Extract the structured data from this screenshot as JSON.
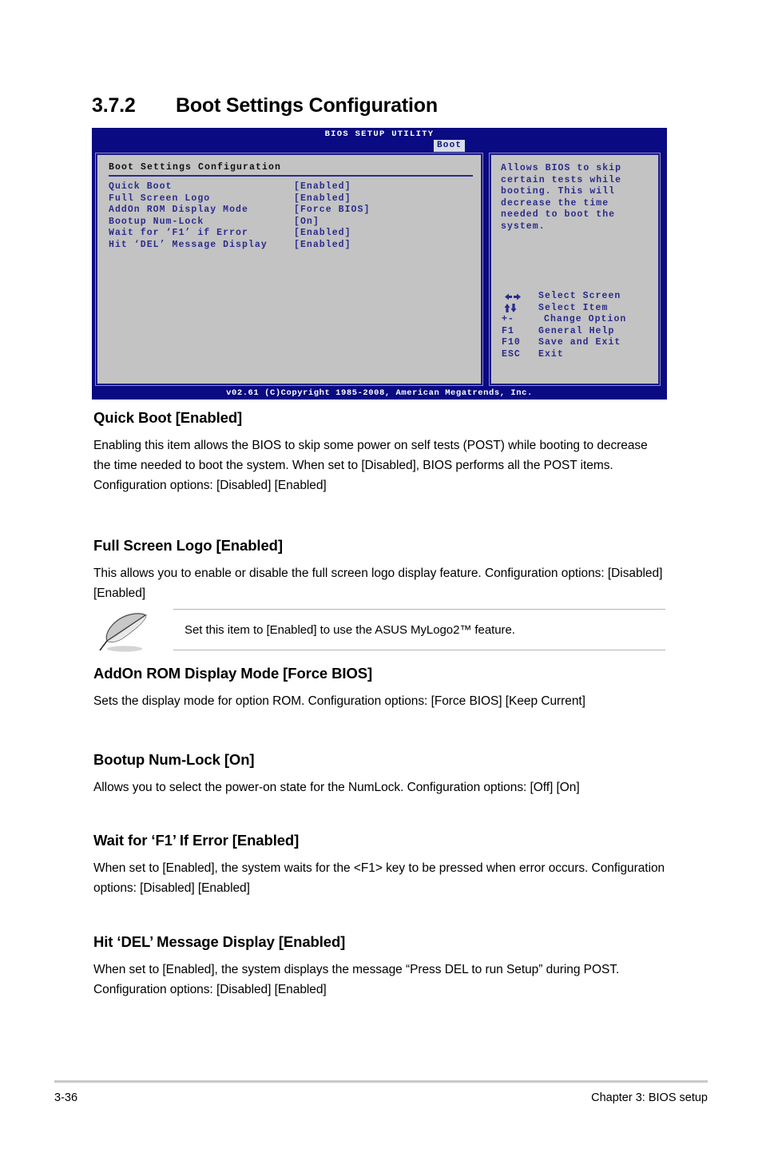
{
  "section": {
    "number": "3.7.2",
    "title": "Boot Settings Configuration"
  },
  "bios": {
    "title": "BIOS SETUP UTILITY",
    "active_tab": "Boot",
    "panel_title": "Boot Settings Configuration",
    "options": [
      {
        "label": "Quick Boot",
        "value": "[Enabled]"
      },
      {
        "label": "Full Screen Logo",
        "value": "[Enabled]"
      },
      {
        "label": "AddOn ROM Display Mode",
        "value": "[Force BIOS]"
      },
      {
        "label": "Bootup Num-Lock",
        "value": "[On]"
      },
      {
        "label": "Wait for ‘F1’ if Error",
        "value": "[Enabled]"
      },
      {
        "label": "Hit ‘DEL’ Message Display",
        "value": "[Enabled]"
      }
    ],
    "help_text": "Allows BIOS to skip\ncertain tests while\nbooting. This will\ndecrease the time\nneeded to boot the\nsystem.",
    "legend": [
      {
        "key": "left-right-arrows",
        "key_text": "",
        "desc": "Select Screen"
      },
      {
        "key": "up-down-arrows",
        "key_text": "",
        "desc": "Select Item"
      },
      {
        "key": "plus-minus",
        "key_text": "+-",
        "desc": "Change Option"
      },
      {
        "key": "f1",
        "key_text": "F1",
        "desc": "General Help"
      },
      {
        "key": "f10",
        "key_text": "F10",
        "desc": "Save and Exit"
      },
      {
        "key": "esc",
        "key_text": "ESC",
        "desc": "Exit"
      }
    ],
    "footer": "v02.61 (C)Copyright 1985-2008, American Megatrends, Inc.",
    "colors": {
      "header_blue": "#0a0a82",
      "panel_gray": "#c3c3c3",
      "text_blue": "#2b2b8c",
      "tab_bg": "#d7dce8"
    }
  },
  "items": [
    {
      "heading": "Quick Boot [Enabled]",
      "paragraph": "Enabling this item allows the BIOS to skip some power on self tests (POST) while booting to decrease the time needed to boot the system. When set to [Disabled], BIOS performs all the POST items.\nConfiguration options: [Disabled] [Enabled]"
    },
    {
      "heading": "Full Screen Logo [Enabled]",
      "paragraph": "This allows you to enable or disable the full screen logo display feature.\nConfiguration options: [Disabled] [Enabled]"
    },
    {
      "heading": "AddOn ROM Display Mode [Force BIOS]",
      "paragraph": "Sets the display mode for option ROM.\nConfiguration options: [Force BIOS] [Keep Current]"
    },
    {
      "heading": "Bootup Num-Lock [On]",
      "paragraph": "Allows you to select the power-on state for the NumLock.\nConfiguration options: [Off] [On]"
    },
    {
      "heading": "Wait for ‘F1’ If Error [Enabled]",
      "paragraph": "When set to [Enabled], the system waits for the <F1> key to be pressed when error occurs.\nConfiguration options: [Disabled] [Enabled]"
    },
    {
      "heading": "Hit ‘DEL’ Message Display [Enabled]",
      "paragraph": "When set to [Enabled], the system displays the message “Press DEL to run Setup” during POST.\nConfiguration options: [Disabled] [Enabled]"
    }
  ],
  "note": {
    "icon": "quill-pen-icon",
    "text": "Set this item to [Enabled] to use the ASUS MyLogo2™ feature."
  },
  "page_footer": {
    "page_number": "3-36",
    "chapter": "Chapter 3: BIOS setup"
  }
}
